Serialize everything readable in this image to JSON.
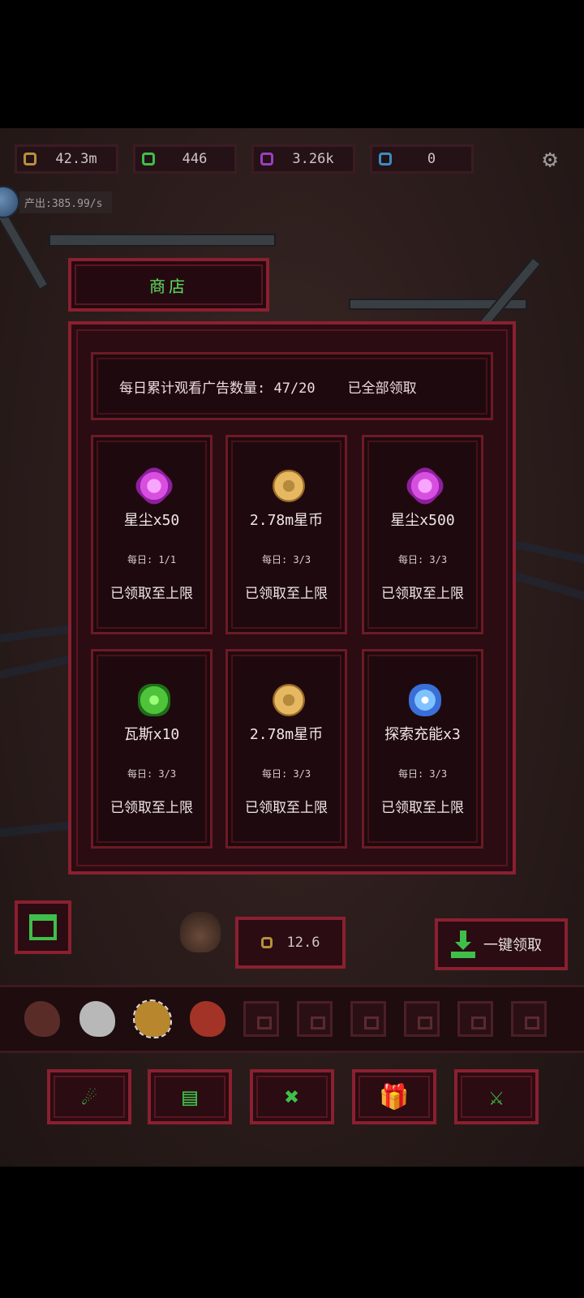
{
  "resources": [
    {
      "name": "gold",
      "value": "42.3m",
      "color": "#b8903a"
    },
    {
      "name": "gas",
      "value": "446",
      "color": "#3fbf4a"
    },
    {
      "name": "stardust",
      "value": "3.26k",
      "color": "#9a3fc0"
    },
    {
      "name": "energy",
      "value": "0",
      "color": "#3a8fc0"
    }
  ],
  "production": {
    "text": "产出:385.99/s"
  },
  "shop": {
    "title": "商店",
    "ad_count": "每日累计观看广告数量: 47/20",
    "ad_status": "已全部领取",
    "cards": [
      {
        "icon": "stardust-icon",
        "name": "星尘x50",
        "daily": "每日: 1/1",
        "status": "已领取至上限"
      },
      {
        "icon": "gold-coin-icon",
        "name": "2.78m星币",
        "daily": "每日: 3/3",
        "status": "已领取至上限"
      },
      {
        "icon": "stardust-icon",
        "name": "星尘x500",
        "daily": "每日: 3/3",
        "status": "已领取至上限"
      },
      {
        "icon": "gas-icon",
        "name": "瓦斯x10",
        "daily": "每日: 3/3",
        "status": "已领取至上限"
      },
      {
        "icon": "gold-coin-icon",
        "name": "2.78m星币",
        "daily": "每日: 3/3",
        "status": "已领取至上限"
      },
      {
        "icon": "explore-charge-icon",
        "name": "探索充能x3",
        "daily": "每日: 3/3",
        "status": "已领取至上限"
      }
    ]
  },
  "bottom": {
    "orb_value": "12.6",
    "claim_all": "一键领取"
  },
  "colors": {
    "accent_green": "#3fbf4a",
    "frame_red": "#8a2030",
    "panel_bg": "#2a0c12"
  }
}
